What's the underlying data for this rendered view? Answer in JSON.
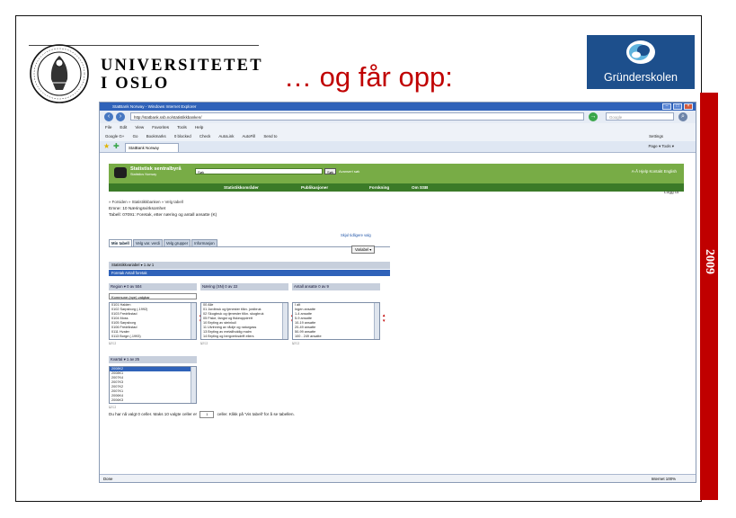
{
  "slide": {
    "university_line1": "UNIVERSITETET",
    "university_line2": "I OSLO",
    "title": "… og får opp:",
    "brand": "Gründerskolen",
    "year": "2009",
    "colors": {
      "title": "#c00000",
      "year_bar": "#c00000",
      "brand_bg": "#1d4f8c"
    }
  },
  "browser": {
    "window_title": "StatBank Norway - Windows Internet Explorer",
    "address": "http://statbank.ssb.no/statistikkbanken/",
    "search_placeholder": "Google",
    "menu": [
      "File",
      "Edit",
      "View",
      "Favorites",
      "Tools",
      "Help"
    ],
    "google_toolbar": [
      "Google G+",
      "Go",
      "Bookmarks",
      "0 blocked",
      "Check",
      "AutoLink",
      "AutoFill",
      "Send to",
      "Settings"
    ],
    "tab_title": "StatBank Norway",
    "tab_tools": "Page ▾  Tools ▾",
    "status": "Done",
    "status_right": "Internet   100%"
  },
  "ssb": {
    "name": "Statistisk sentralbyrå",
    "sub": "Statistics Norway",
    "search_value": "Søk",
    "search_button": "Søk",
    "advanced_link": "Avansert søk",
    "header_right": "A-Å  Hjelp  Kontakt  English",
    "nav": [
      "Statistikkområder",
      "Publikasjoner",
      "Forskning",
      "Om SSB"
    ],
    "breadcrumb": "» Forsiden » Statistikkbanken » Velg tabell",
    "print_link": "Logg ut",
    "emne": "Emne: 10 Næringsvirksomhet",
    "tabell": "Tabell: 07091: Foretak, etter næring og antall ansatte (K)",
    "hide_link": "Skjul tidligere valg",
    "subtabs": [
      "Min tabell",
      "Velg var. verdi",
      "Velg grupper",
      "Informasjon"
    ],
    "variable_button": "Variabel ▾",
    "statistic_row": "Statistikkvariabel ▾       1   av   1",
    "statistic_row_value": "Foretak      Antall foretak",
    "vars": [
      {
        "head": "Region ▾      0  av  504",
        "dropdown": "Kommune (nye) valgbar",
        "rows": [
          "0101  Halden",
          "0102  Sarpsborg (-1992)",
          "0103  Fredrikstad",
          "0104  Moss",
          "0105  Sarpsborg",
          "0106  Fredrikstad",
          "0111  Hvaler",
          "0113  Borge (-1993)"
        ],
        "selected": []
      },
      {
        "head": "Næring (SN)    0  av  22",
        "dropdown": "",
        "rows": [
          "00  Alle",
          "01  Jordbruk og tjenester tilkn. jordbruk",
          "02  Skogbruk og tjenester tilkn. skogbruk",
          "05  Fiske, fangst og fiskeoppdrett",
          "10  Bryting av steinkull",
          "11  Utvinning av råolje og naturgass",
          "13  Bryting av metallholdig malm",
          "14  Bryting og bergverksdrift ellers"
        ],
        "selected": []
      },
      {
        "head": "Antall ansatte     0  av  9",
        "dropdown": "",
        "rows": [
          "I alt",
          "Ingen ansatte",
          "1-4 ansatte",
          "5-9 ansatte",
          "10-19 ansatte",
          "20-49 ansatte",
          "50-99 ansatte",
          "100 - 249 ansatte"
        ],
        "selected": []
      }
    ],
    "time_var": {
      "head": "Kvartal ▾      1  av  25",
      "rows": [
        "2008K2",
        "2008K1",
        "2007K4",
        "2007K3",
        "2007K2",
        "2007K1",
        "2006K4",
        "2006K3"
      ],
      "selected": [
        "2008K2"
      ]
    },
    "footer_before": "Du har nå valgt 0 celler.  Maks 10 valgte celler er",
    "cells_value": "1",
    "footer_after": "celler. Klikk på 'Vis tabell' for å se tabellen."
  }
}
